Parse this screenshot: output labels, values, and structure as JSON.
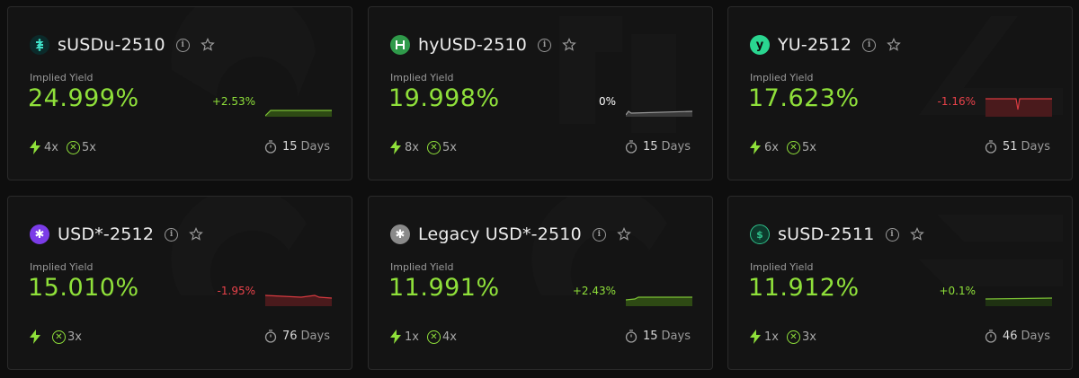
{
  "colors": {
    "green": "#8fe03a",
    "red": "#e8424a",
    "neutral": "#ffffff"
  },
  "cards": [
    {
      "name": "sUSDu-2510",
      "logo_icon": "susdu-logo",
      "label": "Implied Yield",
      "yield": "24.999%",
      "change": "+2.53%",
      "trend": "up",
      "leverage": "4x",
      "multiplier": "5x",
      "days_num": "15",
      "days_unit": "Days"
    },
    {
      "name": "hyUSD-2510",
      "logo_icon": "hyusd-logo",
      "label": "Implied Yield",
      "yield": "19.998%",
      "change": "0%",
      "trend": "flat",
      "leverage": "8x",
      "multiplier": "5x",
      "days_num": "15",
      "days_unit": "Days"
    },
    {
      "name": "YU-2512",
      "logo_icon": "yu-logo",
      "label": "Implied Yield",
      "yield": "17.623%",
      "change": "-1.16%",
      "trend": "down",
      "leverage": "6x",
      "multiplier": "5x",
      "days_num": "51",
      "days_unit": "Days"
    },
    {
      "name": "USD*-2512",
      "logo_icon": "usd-star-logo",
      "label": "Implied Yield",
      "yield": "15.010%",
      "change": "-1.95%",
      "trend": "down",
      "leverage": "",
      "multiplier": "3x",
      "days_num": "76",
      "days_unit": "Days"
    },
    {
      "name": "Legacy USD*-2510",
      "logo_icon": "legacy-usd-star-logo",
      "label": "Implied Yield",
      "yield": "11.991%",
      "change": "+2.43%",
      "trend": "up",
      "leverage": "1x",
      "multiplier": "4x",
      "days_num": "15",
      "days_unit": "Days"
    },
    {
      "name": "sUSD-2511",
      "logo_icon": "susd-logo",
      "label": "Implied Yield",
      "yield": "11.912%",
      "change": "+0.1%",
      "trend": "up",
      "leverage": "1x",
      "multiplier": "3x",
      "days_num": "46",
      "days_unit": "Days"
    }
  ]
}
